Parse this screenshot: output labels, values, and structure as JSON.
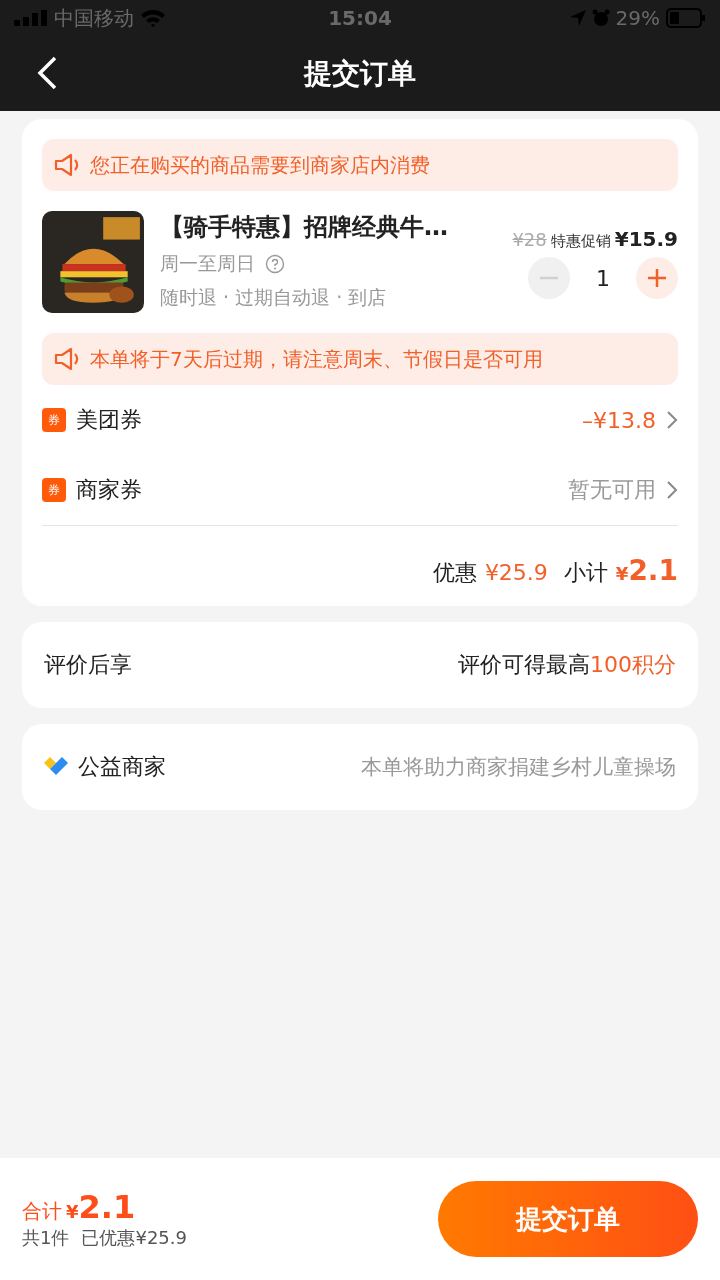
{
  "status_bar": {
    "carrier": "中国移动",
    "time": "15:04",
    "battery": "29%"
  },
  "nav": {
    "title": "提交订单"
  },
  "order_card": {
    "notices": [
      "您正在购买的商品需要到商家店内消费",
      "本单将于7天后过期，请注意周末、节假日是否可用"
    ],
    "product": {
      "title": "【骑手特惠】招牌经典牛…",
      "schedule": "周一至周日",
      "policies": "随时退 · 过期自动退 · 到店",
      "original_price": "¥28",
      "promo_label": "特惠促销",
      "price": "¥15.9",
      "quantity": "1",
      "minus_disabled": true
    },
    "coupons": [
      {
        "badge": "券",
        "label": "美团券",
        "value": "–¥13.8",
        "kind": "discount"
      },
      {
        "badge": "券",
        "label": "商家券",
        "value": "暂无可用",
        "kind": "unavailable"
      }
    ],
    "summary": {
      "discount_label": "优惠",
      "discount": "¥25.9",
      "subtotal_label": "小计",
      "currency": "¥",
      "subtotal": "2.1"
    }
  },
  "review_card": {
    "label": "评价后享",
    "text": "评价可得最高",
    "highlight": "100积分"
  },
  "charity_card": {
    "label": "公益商家",
    "text": "本单将助力商家捐建乡村儿童操场"
  },
  "bottom_bar": {
    "total_label": "合计",
    "currency": "¥",
    "total": "2.1",
    "count": "共1件",
    "saved": "已优惠¥25.9",
    "submit": "提交订单"
  }
}
